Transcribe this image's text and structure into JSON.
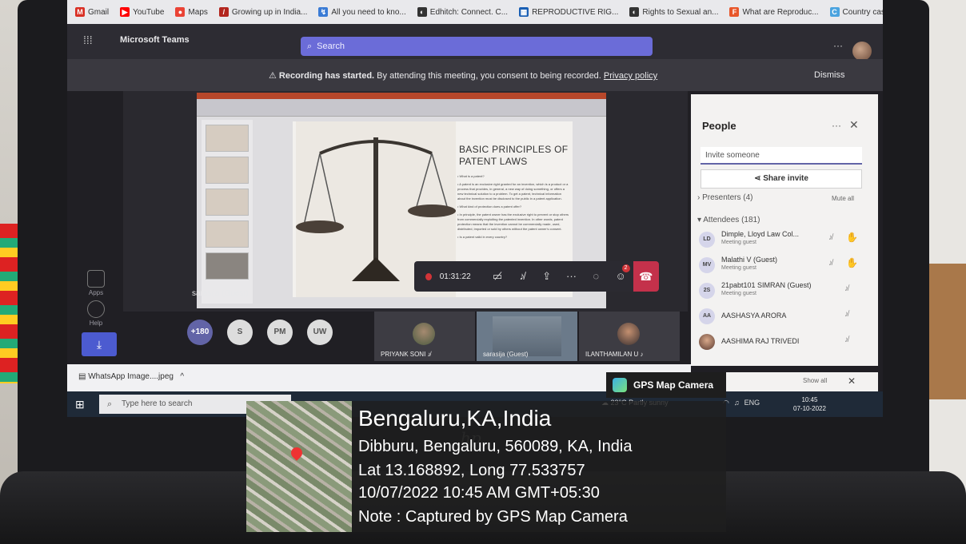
{
  "bookmarks": [
    {
      "label": "Gmail",
      "icon": "gmail-icon",
      "color": "#d93025",
      "glyph": "M"
    },
    {
      "label": "YouTube",
      "icon": "youtube-icon",
      "color": "#ff0000",
      "glyph": "▶"
    },
    {
      "label": "Maps",
      "icon": "maps-icon",
      "color": "#ea4335",
      "glyph": "●"
    },
    {
      "label": "Growing up in India...",
      "icon": "bookmark-icon",
      "color": "#b3261e",
      "glyph": "/"
    },
    {
      "label": "All you need to kno...",
      "icon": "bookmark-icon",
      "color": "#3a7bd5",
      "glyph": "↯"
    },
    {
      "label": "Edhitch: Connect. C...",
      "icon": "bookmark-icon",
      "color": "#333333",
      "glyph": "◐"
    },
    {
      "label": "REPRODUCTIVE RIG...",
      "icon": "bookmark-icon",
      "color": "#1a5fb4",
      "glyph": "▦"
    },
    {
      "label": "Rights to Sexual an...",
      "icon": "bookmark-icon",
      "color": "#333333",
      "glyph": "◐"
    },
    {
      "label": "What are Reproduc...",
      "icon": "bookmark-icon",
      "color": "#e8562a",
      "glyph": "F"
    },
    {
      "label": "Country case-study...",
      "icon": "bookmark-icon",
      "color": "#4aa3df",
      "glyph": "C"
    }
  ],
  "bookmarks_more": "»",
  "teams": {
    "app_name": "Microsoft Teams",
    "search_placeholder": "Search",
    "header_more": "···"
  },
  "banner": {
    "bold": "Recording has started.",
    "text": " By attending this meeting, you consent to being recorded. ",
    "link": "Privacy policy",
    "dismiss": "Dismiss"
  },
  "rail": {
    "apps": "Apps",
    "help": "Help"
  },
  "stage": {
    "presenter": "sarasija (Guest)",
    "slide_title": "BASIC PRINCIPLES OF PATENT LAWS",
    "slide_body": [
      "• What is a patent?",
      "• A patent is an exclusive right granted for an invention, which is a product or a process that provides, in general, a new way of doing something, or offers a new technical solution to a problem. To get a patent, technical information about the invention must be disclosed to the public in a patent application.",
      "• What kind of protection does a patent offer?",
      "• In principle, the patent owner has the exclusive right to prevent or stop others from commercially exploiting the patented invention. In other words, patent protection means that the invention cannot be commercially made, used, distributed, imported or sold by others without the patent owner's consent.",
      "• Is a patent valid in every country?"
    ]
  },
  "controls": {
    "timer": "01:31:22",
    "people_badge": "2"
  },
  "overflow": [
    "+180",
    "S",
    "PM",
    "UW"
  ],
  "tiles": [
    {
      "name": "PRIYANK SONI"
    },
    {
      "name": "sarasija (Guest)"
    },
    {
      "name": "ILANTHAMILAN U"
    }
  ],
  "people": {
    "title": "People",
    "more": "···",
    "invite_placeholder": "Invite someone",
    "share": "Share invite",
    "presenters": "Presenters (4)",
    "mute_all": "Mute all",
    "attendees": "Attendees (181)",
    "list": [
      {
        "initials": "LD",
        "name": "Dimple, Lloyd Law Col...",
        "role": "Meeting guest",
        "hand": true
      },
      {
        "initials": "MV",
        "name": "Malathi V (Guest)",
        "role": "Meeting guest",
        "hand": true
      },
      {
        "initials": "2S",
        "name": "21pabt101 SIMRAN (Guest)",
        "role": "Meeting guest",
        "hand": false
      },
      {
        "initials": "AA",
        "name": "AASHASYA ARORA",
        "role": "",
        "hand": false
      },
      {
        "initials": "",
        "name": "AASHIMA RAJ TRIVEDI",
        "role": "",
        "hand": false
      }
    ],
    "show_all": "Show all"
  },
  "download": {
    "file": "WhatsApp Image....jpeg",
    "chevron": "^"
  },
  "taskbar": {
    "search": "Type here to search",
    "weather": "23°C  Partly sunny",
    "lang": "ENG",
    "time": "10:45",
    "date": "07-10-2022"
  },
  "gps": {
    "tag": "GPS Map Camera",
    "city": "Bengaluru,KA,India",
    "address": "Dibburu, Bengaluru, 560089, KA, India",
    "latlong": "Lat 13.168892, Long 77.533757",
    "datetime": "10/07/2022 10:45 AM GMT+05:30",
    "note": "Note : Captured by GPS Map Camera"
  },
  "hp_logo": "hp"
}
